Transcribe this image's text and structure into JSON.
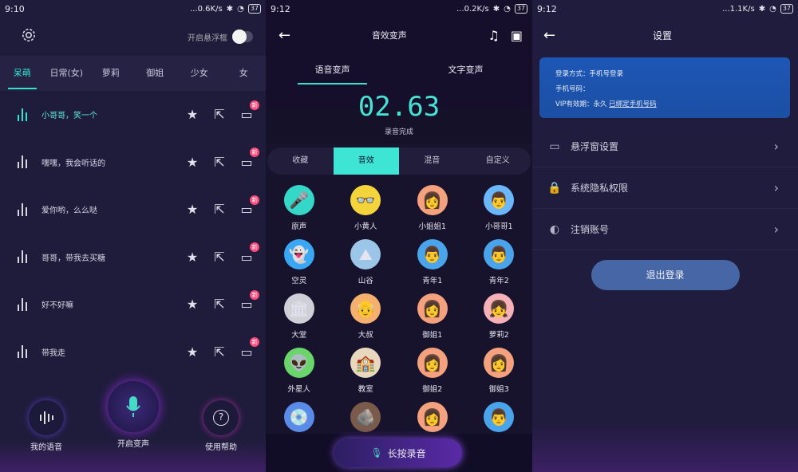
{
  "screen1": {
    "status": {
      "time": "9:10",
      "speed": "...0.6K/s",
      "battery": "37"
    },
    "float_toggle_label": "开启悬浮框",
    "tabs": [
      "呆萌",
      "日常(女)",
      "萝莉",
      "御姐",
      "少女",
      "女"
    ],
    "phrases": [
      "小哥哥，笑一个",
      "嘿嘿，我会听话的",
      "爱你哟，么么哒",
      "哥哥，带我去买糖",
      "好不好嘛",
      "带我走"
    ],
    "new_badge": "新",
    "nav": {
      "my_voice": "我的语音",
      "start_change": "开启变声",
      "help": "使用帮助"
    }
  },
  "screen2": {
    "status": {
      "time": "9:12",
      "speed": "...0.2K/s",
      "battery": "37"
    },
    "title": "音效变声",
    "tabs": [
      "语音变声",
      "文字变声"
    ],
    "timer": "02.63",
    "timer_status": "录音完成",
    "segments": [
      "收藏",
      "音效",
      "混音",
      "自定义"
    ],
    "effects": [
      {
        "label": "原声",
        "bg": "#35d8c8",
        "glyph": "🎤"
      },
      {
        "label": "小黄人",
        "bg": "#f3d43a",
        "glyph": "👓"
      },
      {
        "label": "小姐姐1",
        "bg": "#f5a17e",
        "glyph": "👩"
      },
      {
        "label": "小哥哥1",
        "bg": "#6ab7ff",
        "glyph": "👨"
      },
      {
        "label": "空灵",
        "bg": "#3aa7f5",
        "glyph": "👻"
      },
      {
        "label": "山谷",
        "bg": "#9cc6e8",
        "glyph": "⛰"
      },
      {
        "label": "青年1",
        "bg": "#4aa4ec",
        "glyph": "👨"
      },
      {
        "label": "青年2",
        "bg": "#4aa4ec",
        "glyph": "👨"
      },
      {
        "label": "大堂",
        "bg": "#cfcfd8",
        "glyph": "🏛"
      },
      {
        "label": "大叔",
        "bg": "#f5b06e",
        "glyph": "👴"
      },
      {
        "label": "御姐1",
        "bg": "#f5a17e",
        "glyph": "👩"
      },
      {
        "label": "萝莉2",
        "bg": "#f5b0b8",
        "glyph": "👧"
      },
      {
        "label": "外星人",
        "bg": "#6ad56a",
        "glyph": "👽"
      },
      {
        "label": "教室",
        "bg": "#e8d8c0",
        "glyph": "🏫"
      },
      {
        "label": "御姐2",
        "bg": "#f5a17e",
        "glyph": "👩"
      },
      {
        "label": "御姐3",
        "bg": "#f5a17e",
        "glyph": "👩"
      },
      {
        "label": "",
        "bg": "#5a8be8",
        "glyph": "💿"
      },
      {
        "label": "",
        "bg": "#7a5a4a",
        "glyph": "🪨"
      },
      {
        "label": "",
        "bg": "#f5a17e",
        "glyph": "👩"
      },
      {
        "label": "",
        "bg": "#4aa4ec",
        "glyph": "👨"
      }
    ],
    "record_label": "长按录音"
  },
  "screen3": {
    "status": {
      "time": "9:12",
      "speed": "...1.1K/s",
      "battery": "37"
    },
    "title": "设置",
    "card": {
      "login_method": "登录方式：手机号登录",
      "phone": "手机号码：",
      "vip_prefix": "VIP有效期：永久",
      "vip_link": "已绑定手机号码"
    },
    "settings": [
      "悬浮窗设置",
      "系统隐私权限",
      "注销账号"
    ],
    "logout": "退出登录"
  },
  "colors": {
    "accent": "#33e1d1",
    "badge": "#ff4b7b",
    "card": "#1d57b5",
    "logout": "#4766a5"
  }
}
